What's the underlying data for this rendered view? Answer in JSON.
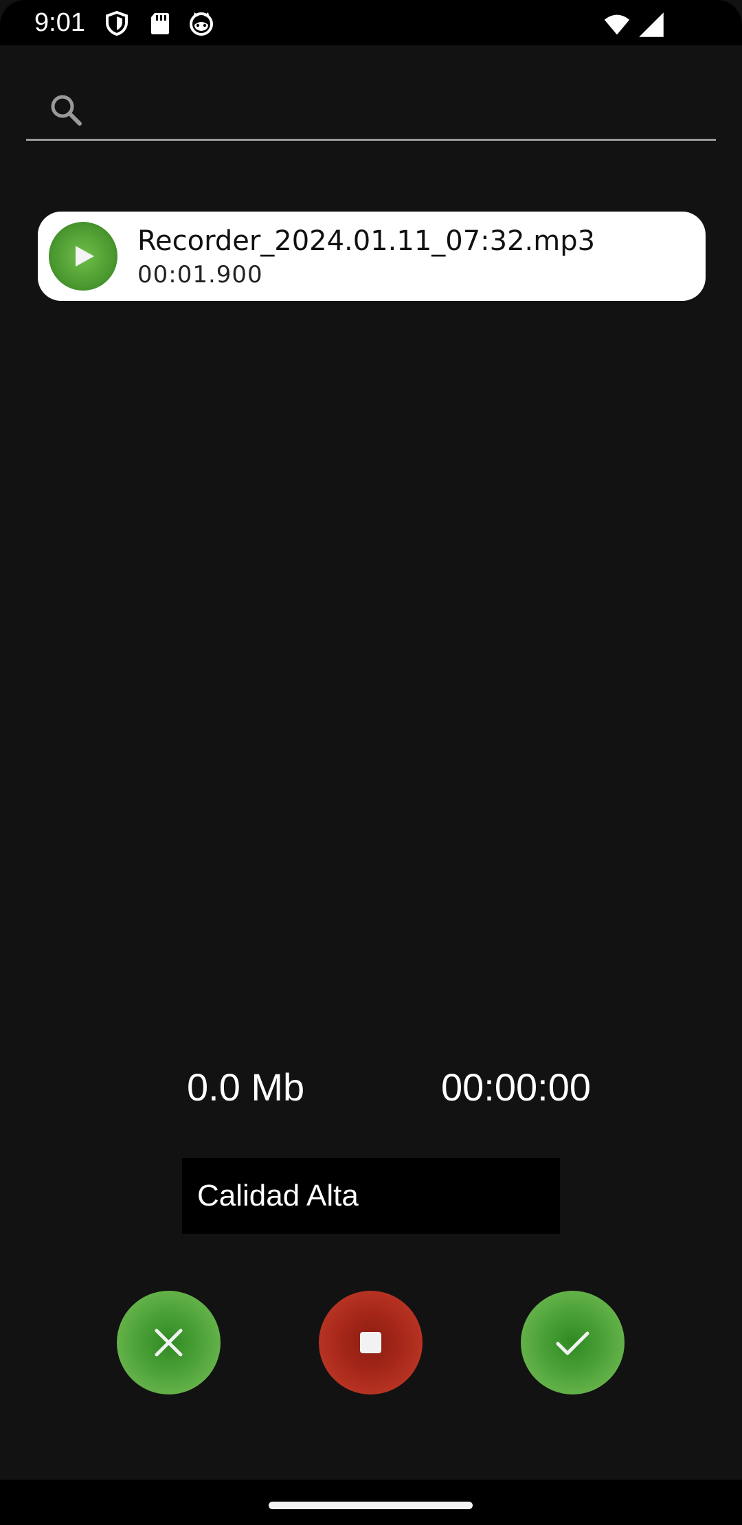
{
  "status_bar": {
    "time": "9:01",
    "icons": [
      "shield-icon",
      "sd-card-icon",
      "cat-face-icon",
      "wifi-icon",
      "cell-signal-icon"
    ]
  },
  "search": {
    "placeholder": "",
    "value": ""
  },
  "recordings": [
    {
      "title": "Recorder_2024.01.11_07:32.mp3",
      "duration": "00:01.900"
    }
  ],
  "stats": {
    "size": "0.0 Mb",
    "elapsed": "00:00:00"
  },
  "quality": {
    "selected": "Calidad Alta"
  },
  "actions": {
    "cancel_icon": "close-icon",
    "stop_icon": "stop-icon",
    "confirm_icon": "check-icon"
  },
  "colors": {
    "background": "#121212",
    "green": "#4ea33a",
    "red": "#a8281a",
    "card": "#ffffff"
  }
}
